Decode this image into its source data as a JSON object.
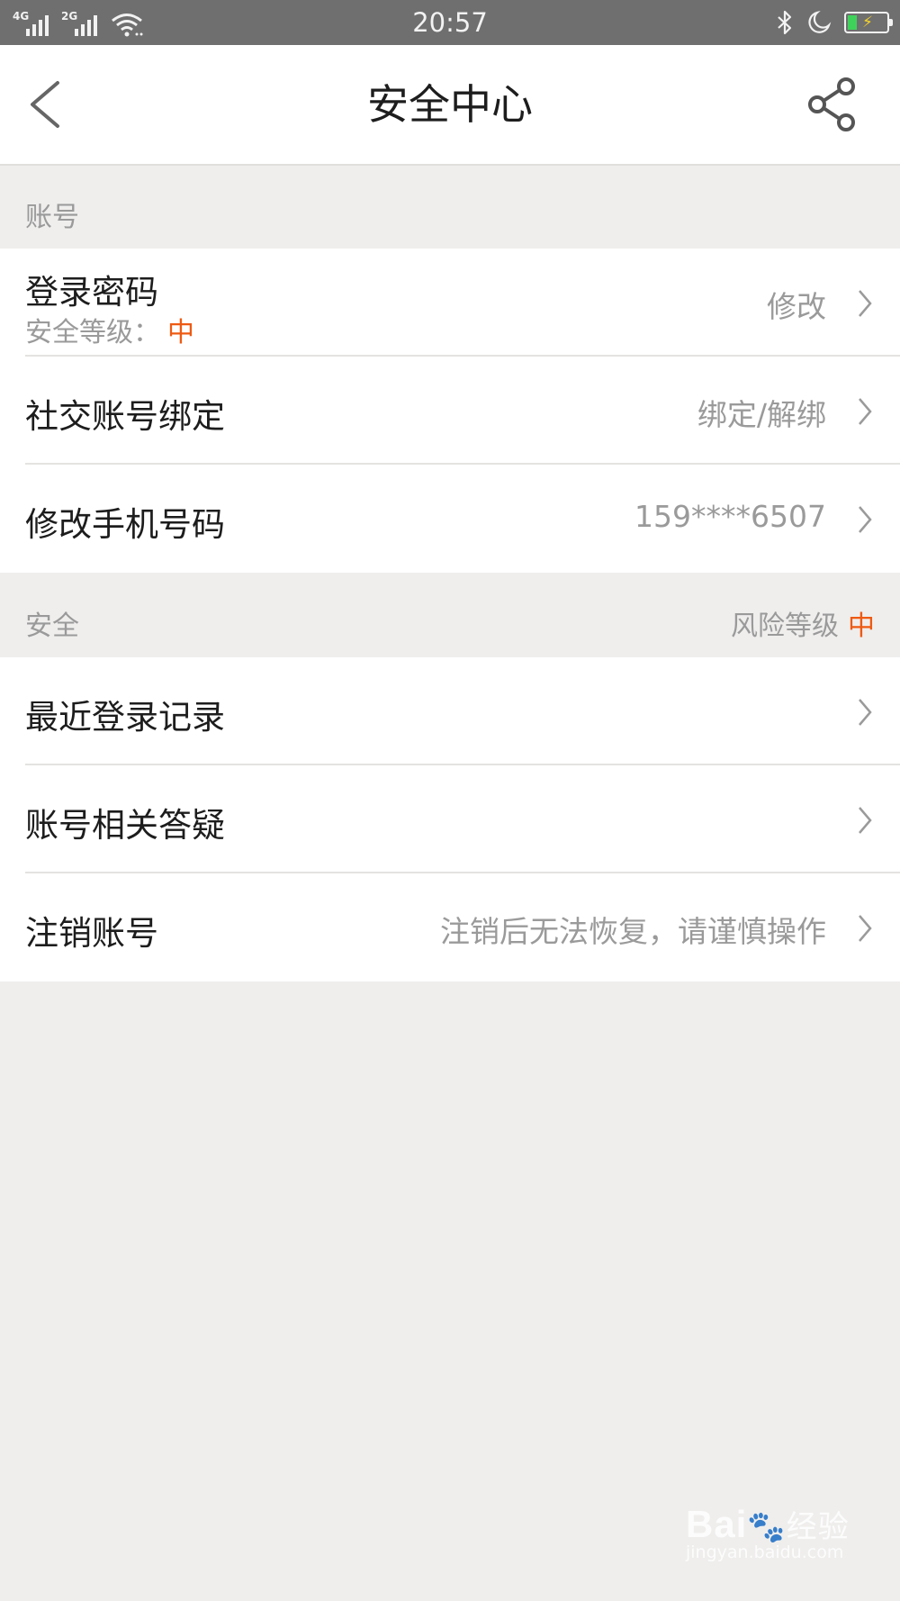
{
  "status_bar": {
    "network1": "4G",
    "network2": "2G",
    "time": "20:57",
    "icons": [
      "signal-icon",
      "wifi-icon",
      "bluetooth-icon",
      "moon-icon",
      "battery-charging-icon"
    ],
    "battery_color": "#3fd25a"
  },
  "header": {
    "title": "安全中心",
    "back_icon": "back-icon",
    "share_icon": "share-icon"
  },
  "account_section": {
    "title": "账号",
    "items": [
      {
        "label": "登录密码",
        "sub_label": "安全等级：",
        "sub_value": "中",
        "value": "修改"
      },
      {
        "label": "社交账号绑定",
        "value": "绑定/解绑"
      },
      {
        "label": "修改手机号码",
        "value": "159****6507"
      }
    ]
  },
  "security_section": {
    "title": "安全",
    "risk_label": "风险等级",
    "risk_value": "中",
    "items": [
      {
        "label": "最近登录记录",
        "value": ""
      },
      {
        "label": "账号相关答疑",
        "value": ""
      },
      {
        "label": "注销账号",
        "value": "注销后无法恢复，请谨慎操作"
      }
    ]
  },
  "watermark": {
    "brand": "Bai",
    "brand_suffix": "经验",
    "url": "jingyan.baidu.com"
  },
  "colors": {
    "accent": "#ee5a12",
    "background": "#efeeed",
    "text_primary": "#1d1d1d",
    "text_secondary": "#9a9a9a"
  }
}
